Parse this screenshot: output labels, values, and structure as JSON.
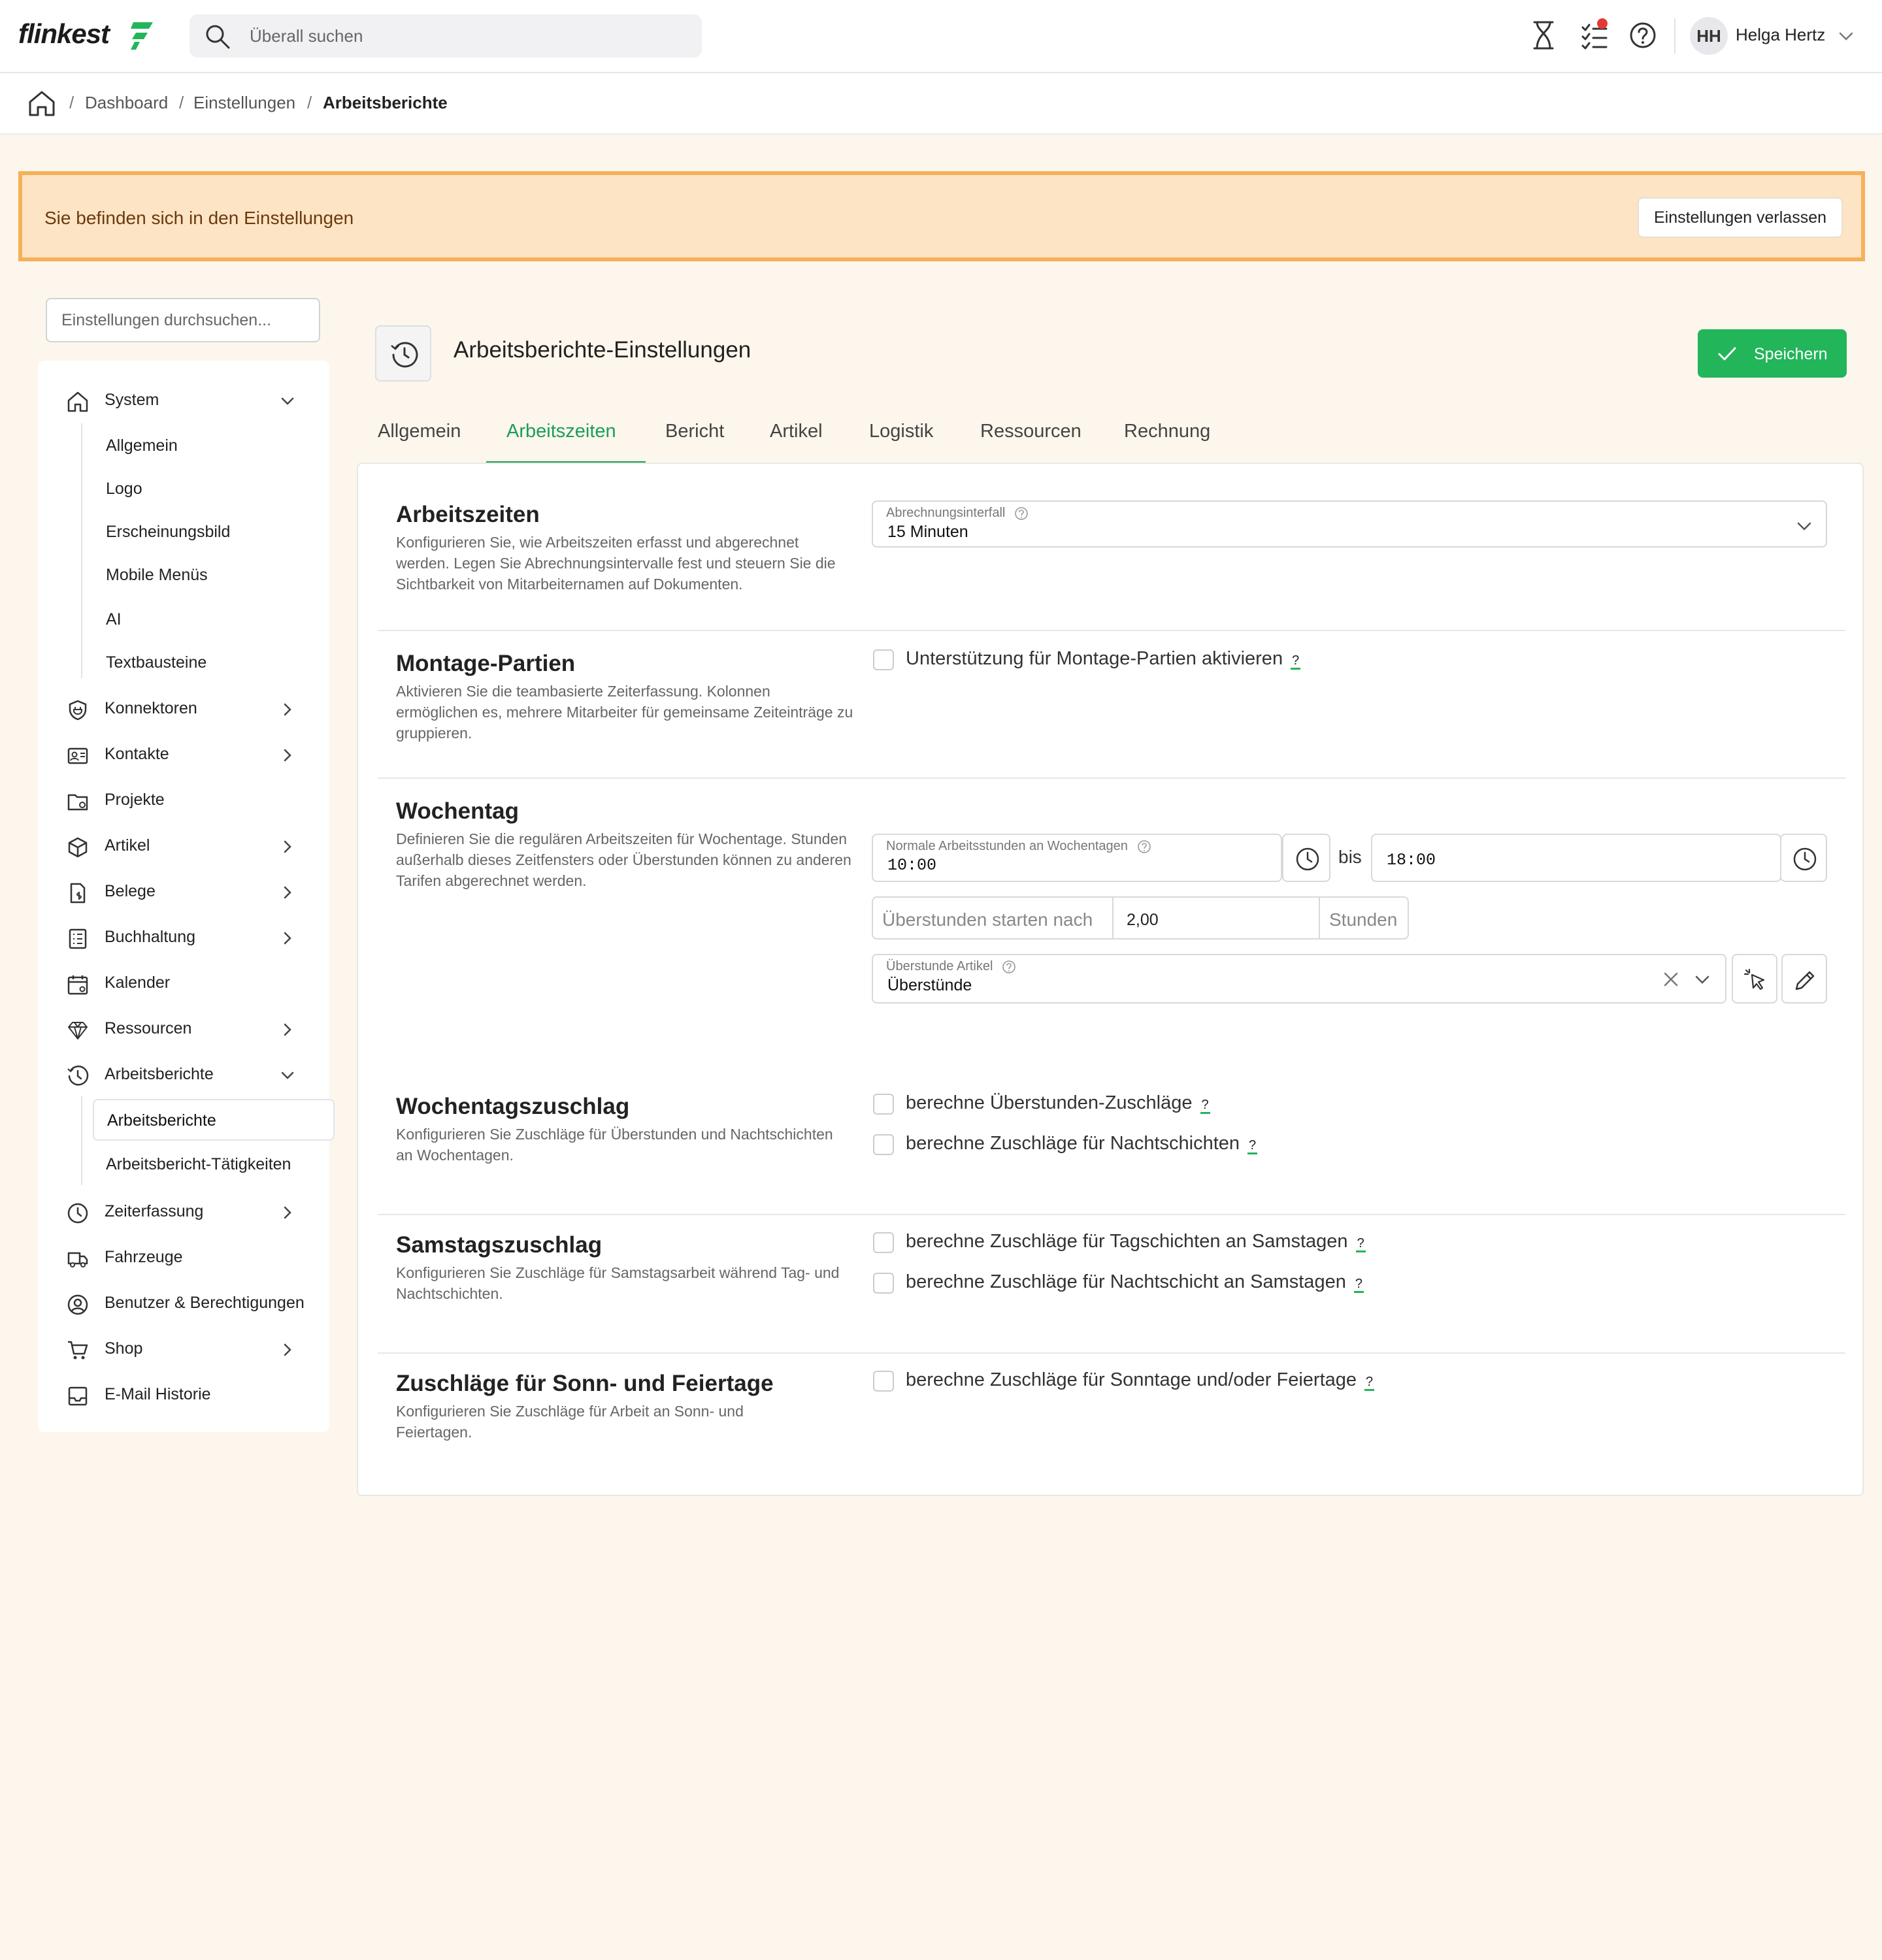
{
  "topbar": {
    "logo_text": "flinkest",
    "search_placeholder": "Überall suchen",
    "user_initials": "HH",
    "user_name": "Helga Hertz"
  },
  "breadcrumb": [
    "Dashboard",
    "Einstellungen",
    "Arbeitsberichte"
  ],
  "banner": {
    "text": "Sie befinden sich in den Einstellungen",
    "button": "Einstellungen verlassen"
  },
  "sidebar": {
    "search_placeholder": "Einstellungen durchsuchen...",
    "system": "System",
    "system_sub": [
      "Allgemein",
      "Logo",
      "Erscheinungsbild",
      "Mobile Menüs",
      "AI",
      "Textbausteine"
    ],
    "items": [
      "Konnektoren",
      "Kontakte",
      "Projekte",
      "Artikel",
      "Belege",
      "Buchhaltung",
      "Kalender",
      "Ressourcen",
      "Arbeitsberichte"
    ],
    "arbeitsberichte_sub": [
      "Arbeitsberichte",
      "Arbeitsbericht-Tätigkeiten"
    ],
    "items_after": [
      "Zeiterfassung",
      "Fahrzeuge",
      "Benutzer & Berechtigungen",
      "Shop",
      "E-Mail Historie"
    ]
  },
  "page": {
    "title": "Arbeitsberichte-Einstellungen",
    "save": "Speichern"
  },
  "tabs": [
    "Allgemein",
    "Arbeitszeiten",
    "Bericht",
    "Artikel",
    "Logistik",
    "Ressourcen",
    "Rechnung"
  ],
  "active_tab": "Arbeitszeiten",
  "sections": {
    "arbeitszeiten": {
      "title": "Arbeitszeiten",
      "desc": "Konfigurieren Sie, wie Arbeitszeiten erfasst und abgerechnet werden. Legen Sie Abrechnungsintervalle fest und steuern Sie die Sichtbarkeit von Mitarbeiternamen auf Dokumenten.",
      "interval_label": "Abrechnungsinterfall",
      "interval_value": "15 Minuten"
    },
    "montage": {
      "title": "Montage-Partien",
      "desc": "Aktivieren Sie die teambasierte Zeiterfassung. Kolonnen ermöglichen es, mehrere Mitarbeiter für gemeinsame Zeiteinträge zu gruppieren.",
      "checkbox": "Unterstützung für Montage-Partien aktivieren"
    },
    "wochentag": {
      "title": "Wochentag",
      "desc": "Definieren Sie die regulären Arbeitszeiten für Wochentage. Stunden außerhalb dieses Zeitfensters oder Überstunden können zu anderen Tarifen abgerechnet werden.",
      "hours_label": "Normale Arbeitsstunden an Wochentagen",
      "from": "10:00",
      "bis": "bis",
      "to": "18:00",
      "overtime_prefix": "Überstunden starten nach",
      "overtime_value": "2,00",
      "overtime_suffix": "Stunden",
      "article_label": "Überstunde Artikel",
      "article_value": "Überstünde"
    },
    "wochentagszuschlag": {
      "title": "Wochentagszuschlag",
      "desc": "Konfigurieren Sie Zuschläge für Überstunden und Nachtschichten an Wochentagen.",
      "cb1": "berechne Überstunden-Zuschläge",
      "cb2": "berechne Zuschläge für Nachtschichten"
    },
    "samstag": {
      "title": "Samstagszuschlag",
      "desc": "Konfigurieren Sie Zuschläge für Samstagsarbeit während Tag- und Nachtschichten.",
      "cb1": "berechne Zuschläge für Tagschichten an Samstagen",
      "cb2": "berechne Zuschläge für Nachtschicht an Samstagen"
    },
    "sonntag": {
      "title": "Zuschläge für Sonn- und Feiertage",
      "desc": "Konfigurieren Sie Zuschläge für Arbeit an Sonn- und Feiertagen.",
      "cb1": "berechne Zuschläge für Sonntage und/oder Feiertage"
    }
  },
  "help_mark": "?",
  "colors": {
    "accent": "#1a9e5a",
    "save": "#22b55a",
    "banner_bg": "#fde4c4",
    "banner_border": "#f5b15a"
  }
}
